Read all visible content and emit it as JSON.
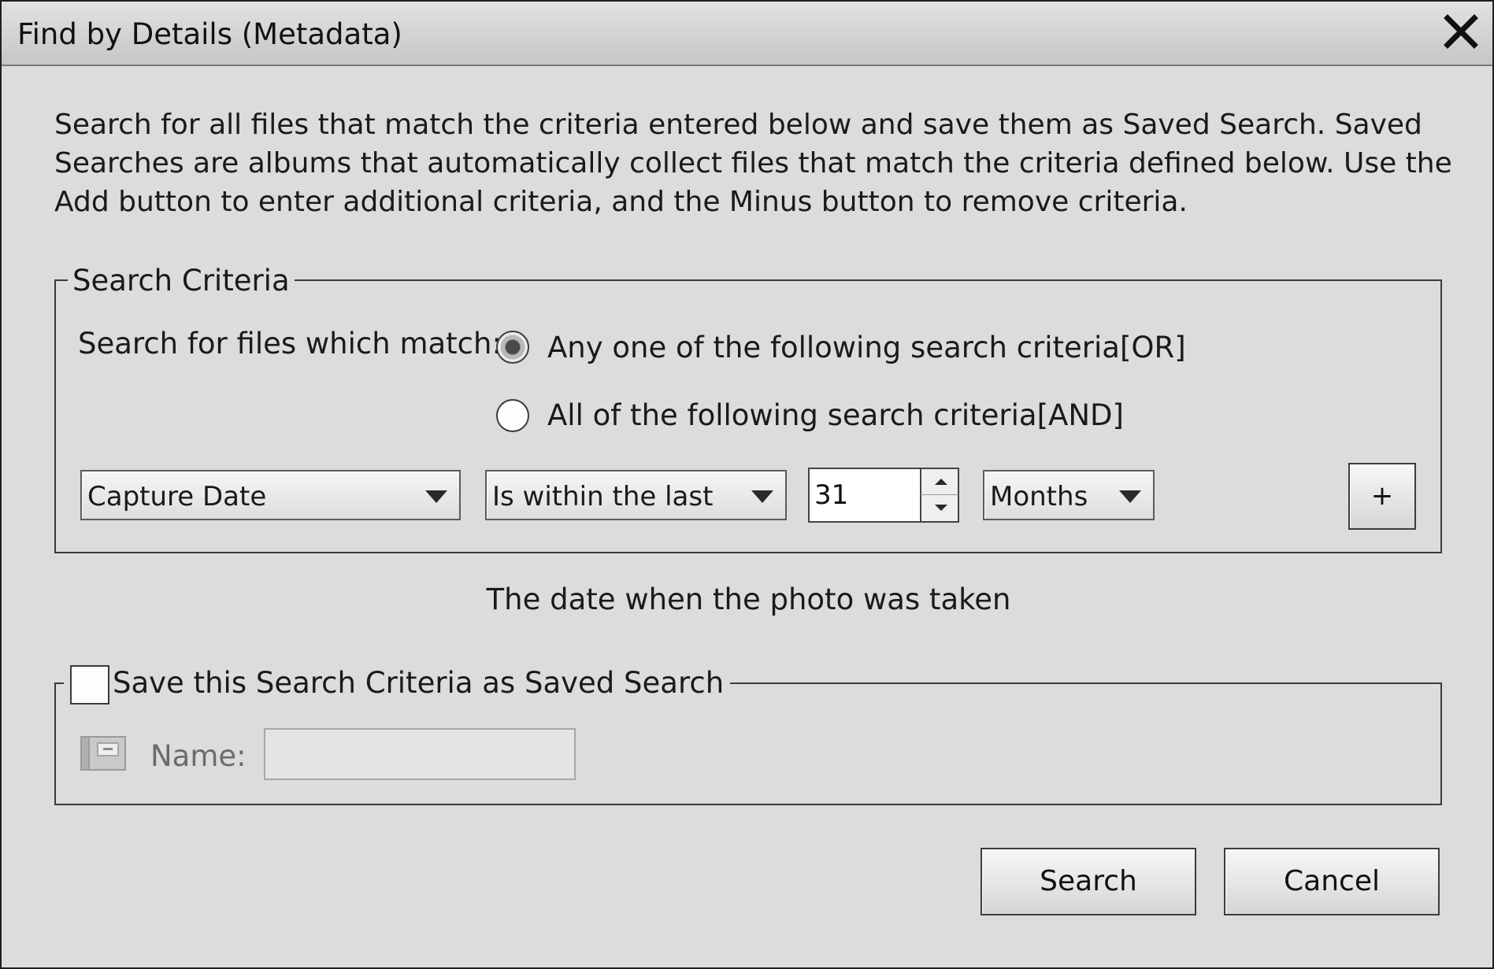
{
  "dialog": {
    "title": "Find by Details (Metadata)",
    "close_icon": "close-icon"
  },
  "description": {
    "lines": [
      "Search for all files that match the criteria entered below and save them as Saved Search. Saved",
      "Searches are albums that automatically collect files that match the criteria defined below. Use the",
      "Add button to enter additional criteria, and the Minus button to remove criteria."
    ]
  },
  "criteria": {
    "legend": "Search Criteria",
    "match_label": "Search for files which match:",
    "options": [
      {
        "label": "Any one of the following search criteria[OR]",
        "checked": true
      },
      {
        "label": "All of the following search criteria[AND]",
        "checked": false
      }
    ],
    "row": {
      "field": "Capture Date",
      "operator": "Is within the last",
      "value": "31",
      "unit": "Months"
    },
    "add_label": "+"
  },
  "hint": "The date when the photo was taken",
  "saved_search": {
    "checkbox_label": "Save this Search Criteria as Saved Search",
    "checked": false,
    "name_label": "Name:",
    "name_value": "",
    "icon": "album-icon"
  },
  "buttons": {
    "search": "Search",
    "cancel": "Cancel"
  }
}
